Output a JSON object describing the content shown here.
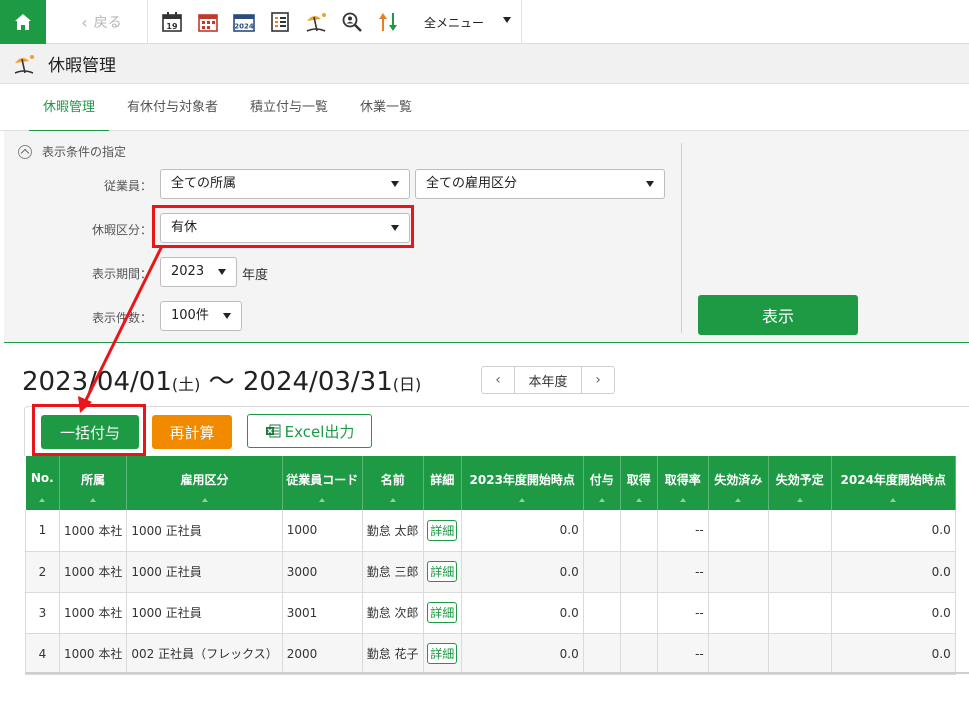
{
  "topbar": {
    "back_label": "戻る",
    "menu_label": "全メニュー",
    "tools": [
      {
        "icon": "calendar-19-icon"
      },
      {
        "icon": "calendar-grid-icon"
      },
      {
        "icon": "calendar-2024-icon"
      },
      {
        "icon": "list-checklist-icon"
      },
      {
        "icon": "beach-umbrella-icon"
      },
      {
        "icon": "search-person-icon"
      },
      {
        "icon": "sort-updown-icon"
      }
    ]
  },
  "titlebar": {
    "title": "休暇管理",
    "icon": "beach-umbrella-icon"
  },
  "tabs": [
    {
      "label": "休暇管理",
      "active": true
    },
    {
      "label": "有休付与対象者"
    },
    {
      "label": "積立付与一覧"
    },
    {
      "label": "休業一覧"
    }
  ],
  "filter": {
    "heading": "表示条件の指定",
    "employee_label": "従業員：",
    "dept_value": "全ての所属",
    "emptype_value": "全ての雇用区分",
    "leave_label": "休暇区分：",
    "leave_value": "有休",
    "period_label": "表示期間：",
    "period_value": "2023",
    "period_unit": "年度",
    "count_label": "表示件数：",
    "count_value": "100件",
    "show_button": "表示"
  },
  "range": {
    "start": "2023/04/01",
    "start_dow": "(土)",
    "sep": " 〜 ",
    "end": "2024/03/31",
    "end_dow": "(日)"
  },
  "year_nav": {
    "prev": "‹",
    "label": "本年度",
    "next": "›"
  },
  "actions": {
    "bulk_grant": "一括付与",
    "recalc": "再計算",
    "excel": "Excel出力"
  },
  "table": {
    "headers": [
      "No.",
      "所属",
      "雇用区分",
      "従業員コード",
      "名前",
      "詳細",
      "2023年度開始時点",
      "付与",
      "取得",
      "取得率",
      "失効済み",
      "失効予定",
      "2024年度開始時点"
    ],
    "rows": [
      {
        "no": "1",
        "dept": "1000 本社",
        "type": "1000 正社員",
        "code": "1000",
        "name": "勤怠 太郎",
        "detail": "詳細",
        "start": "0.0",
        "grant": "",
        "take": "",
        "rate": "--",
        "expired": "",
        "expiring": "",
        "end": "0.0"
      },
      {
        "no": "2",
        "dept": "1000 本社",
        "type": "1000 正社員",
        "code": "3000",
        "name": "勤怠 三郎",
        "detail": "詳細",
        "start": "0.0",
        "grant": "",
        "take": "",
        "rate": "--",
        "expired": "",
        "expiring": "",
        "end": "0.0"
      },
      {
        "no": "3",
        "dept": "1000 本社",
        "type": "1000 正社員",
        "code": "3001",
        "name": "勤怠 次郎",
        "detail": "詳細",
        "start": "0.0",
        "grant": "",
        "take": "",
        "rate": "--",
        "expired": "",
        "expiring": "",
        "end": "0.0"
      },
      {
        "no": "4",
        "dept": "1000 本社",
        "type": "002 正社員（フレックス）",
        "code": "2000",
        "name": "勤怠 花子",
        "detail": "詳細",
        "start": "0.0",
        "grant": "",
        "take": "",
        "rate": "--",
        "expired": "",
        "expiring": "",
        "end": "0.0"
      }
    ]
  },
  "colors": {
    "brand_green": "#1e9a45",
    "orange": "#f28a00",
    "annotation_red": "#e8161b"
  }
}
